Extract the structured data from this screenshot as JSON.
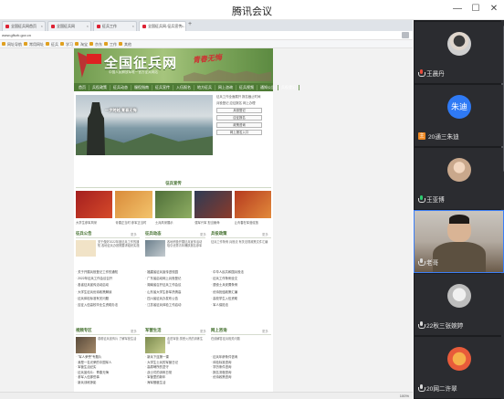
{
  "app": {
    "title": "腾讯会议",
    "minimize": "—",
    "maximize": "☐",
    "close": "✕"
  },
  "browser": {
    "tabs": [
      {
        "label": "全国征兵网首页"
      },
      {
        "label": "全国征兵网"
      },
      {
        "label": "征兵工作"
      },
      {
        "label": "全国征兵网-征兵宣传..."
      }
    ],
    "new_tab": "+",
    "url": "www.gfbzb.gov.cn",
    "bookmarks": [
      "网址导航",
      "常用网址",
      "征兵",
      "学习",
      "淘宝",
      "京东",
      "工作",
      "其他"
    ],
    "zoom": "100%"
  },
  "site": {
    "name": "全国征兵网",
    "subtitle": "中国人民解放军唯一官方征兵网站",
    "slogan": "青春无悔",
    "nav": [
      "首页",
      "兵役政策",
      "征兵动态",
      "服役指南",
      "征兵宣传",
      "入伍报名",
      "地方征兵",
      "网上咨询",
      "征兵视频",
      "通知公告",
      "兵役登记"
    ],
    "hero_caption": "一步跨越 青春无悔",
    "side_box": {
      "line1": "征兵工作全面展开 报名截止时间",
      "line2": "兵役登记 应征报名 网上办理",
      "buttons": [
        "兵役登记",
        "应征报名",
        "政策咨询",
        "网上报名入口"
      ]
    },
    "section_feature": "征兵宣传",
    "thumb_captions": [
      "大学生参军风采",
      "青春正当时 参军正当时",
      "士兵风采展示",
      "强军兴军 担当使命",
      "让青春在军营绽放"
    ],
    "col1": {
      "head": "征兵公告",
      "more": "更多",
      "blurb": "关于做好2022年度征兵工作的通知 各地征兵办按照要求组织实施",
      "items": [
        "关于开展兵役登记工作的通知",
        "2022年征兵工作会议召开",
        "各省征兵宣传活动启动",
        "大学生征兵优待政策解读",
        "征兵体检标准有关问题",
        "应征入伍高校毕业生资助办法"
      ]
    },
    "col2": {
      "head": "征兵动态",
      "more": "更多",
      "blurb": "各地积极开展征兵宣传活动 吸引优秀青年踊跃报名参军",
      "items": [
        "福建省征兵宣传进校园",
        "广东省启动网上兵役登记",
        "湖南省召开征兵工作会议",
        "山东省大学生参军热情高",
        "四川省征兵办发布公告",
        "江苏省征兵体检工作启动"
      ]
    },
    "col3": {
      "head": "兵役政策",
      "more": "更多",
      "blurb": "征兵工作条例 兵役法 有关法规政策文件汇编",
      "items": [
        "中华人民共和国兵役法",
        "征兵工作条例全文",
        "退役士兵安置条例",
        "优待抚恤政策汇编",
        "高校学生入伍资助",
        "军人保险法"
      ]
    },
    "row2_col1": {
      "head": "视频专区",
      "more": "更多",
      "blurb": "观看征兵宣传片 了解军营生活",
      "items": [
        "\"军人荣誉\"专题片",
        "我是一名光荣的中国军人",
        "军营生活纪实",
        "征兵宣传片：青春无悔",
        "参军入伍那些事",
        "新兵训练掠影"
      ]
    },
    "row2_col2": {
      "head": "军营生活",
      "more": "更多",
      "blurb": "走进军营 感受火热的训练生活",
      "items": [
        "新兵下连第一课",
        "大学生士兵的军营日记",
        "高原哨所的坚守",
        "战士们的训练日常",
        "军营里的新年",
        "海军舰艇生活"
      ]
    },
    "row2_col3": {
      "head": "网上咨询",
      "more": "更多",
      "blurb": "在线解答征兵相关问题",
      "items": [
        "征兵年龄条件咨询",
        "体检标准咨询",
        "学历条件咨询",
        "报名流程咨询",
        "优待政策咨询"
      ]
    }
  },
  "participants": [
    {
      "name": "王晨丹",
      "avatar": "photo",
      "mic": "muted",
      "host": false,
      "color": "#cfcfcf"
    },
    {
      "name": "20通三朱迪",
      "avatar": "朱迪",
      "mic": "on",
      "host": true,
      "color": "#2f7af5"
    },
    {
      "name": "王亚博",
      "avatar": "photo",
      "mic": "speaking",
      "host": false,
      "color": "#c9a88c"
    },
    {
      "name": "老哥",
      "avatar": "video",
      "mic": "on",
      "host": false,
      "color": "#6b5b4a"
    },
    {
      "name": "22秋三张婉婷",
      "avatar": "photo",
      "mic": "on",
      "host": false,
      "color": "#bdbdbd"
    },
    {
      "name": "20网二许翠",
      "avatar": "photo",
      "mic": "on",
      "host": false,
      "color": "#e85b3a"
    }
  ]
}
